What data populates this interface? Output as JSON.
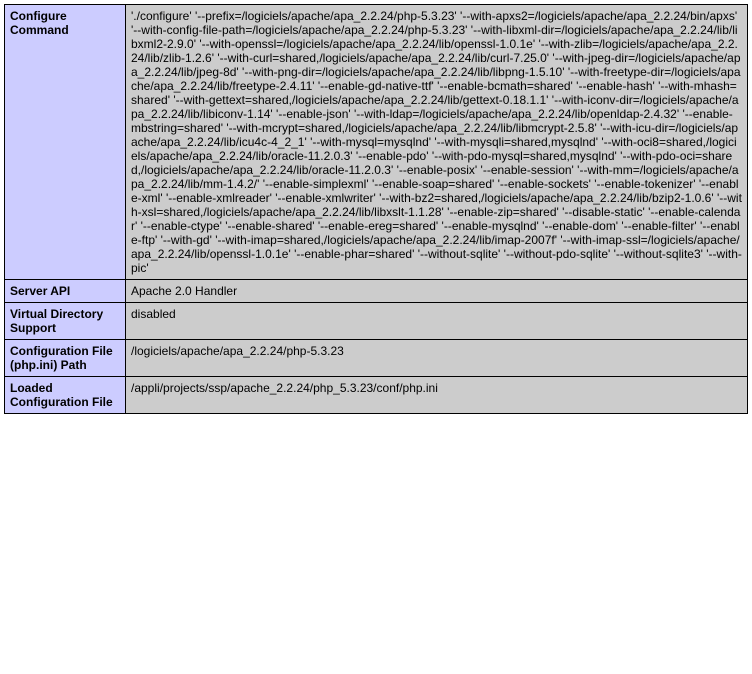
{
  "rows": [
    {
      "label": "Configure Command",
      "value": "'./configure' '--prefix=/logiciels/apache/apa_2.2.24/php-5.3.23' '--with-apxs2=/logiciels/apache/apa_2.2.24/bin/apxs' '--with-config-file-path=/logiciels/apache/apa_2.2.24/php-5.3.23' '--with-libxml-dir=/logiciels/apache/apa_2.2.24/lib/libxml2-2.9.0' '--with-openssl=/logiciels/apache/apa_2.2.24/lib/openssl-1.0.1e' '--with-zlib=/logiciels/apache/apa_2.2.24/lib/zlib-1.2.6' '--with-curl=shared,/logiciels/apache/apa_2.2.24/lib/curl-7.25.0' '--with-jpeg-dir=/logiciels/apache/apa_2.2.24/lib/jpeg-8d' '--with-png-dir=/logiciels/apache/apa_2.2.24/lib/libpng-1.5.10' '--with-freetype-dir=/logiciels/apache/apa_2.2.24/lib/freetype-2.4.11' '--enable-gd-native-ttf' '--enable-bcmath=shared' '--enable-hash' '--with-mhash=shared' '--with-gettext=shared,/logiciels/apache/apa_2.2.24/lib/gettext-0.18.1.1' '--with-iconv-dir=/logiciels/apache/apa_2.2.24/lib/libiconv-1.14' '--enable-json' '--with-ldap=/logiciels/apache/apa_2.2.24/lib/openldap-2.4.32' '--enable-mbstring=shared' '--with-mcrypt=shared,/logiciels/apache/apa_2.2.24/lib/libmcrypt-2.5.8' '--with-icu-dir=/logiciels/apache/apa_2.2.24/lib/icu4c-4_2_1' '--with-mysql=mysqlnd' '--with-mysqli=shared,mysqlnd' '--with-oci8=shared,/logiciels/apache/apa_2.2.24/lib/oracle-11.2.0.3' '--enable-pdo' '--with-pdo-mysql=shared,mysqlnd' '--with-pdo-oci=shared,/logiciels/apache/apa_2.2.24/lib/oracle-11.2.0.3' '--enable-posix' '--enable-session' '--with-mm=/logiciels/apache/apa_2.2.24/lib/mm-1.4.2/' '--enable-simplexml' '--enable-soap=shared' '--enable-sockets' '--enable-tokenizer' '--enable-xml' '--enable-xmlreader' '--enable-xmlwriter' '--with-bz2=shared,/logiciels/apache/apa_2.2.24/lib/bzip2-1.0.6' '--with-xsl=shared,/logiciels/apache/apa_2.2.24/lib/libxslt-1.1.28' '--enable-zip=shared' '--disable-static' '--enable-calendar' '--enable-ctype' '--enable-shared' '--enable-ereg=shared' '--enable-mysqlnd' '--enable-dom' '--enable-filter' '--enable-ftp' '--with-gd' '--with-imap=shared,/logiciels/apache/apa_2.2.24/lib/imap-2007f' '--with-imap-ssl=/logiciels/apache/apa_2.2.24/lib/openssl-1.0.1e' '--enable-phar=shared' '--without-sqlite' '--without-pdo-sqlite' '--without-sqlite3' '--with-pic'"
    },
    {
      "label": "Server API",
      "value": "Apache 2.0 Handler"
    },
    {
      "label": "Virtual Directory Support",
      "value": "disabled"
    },
    {
      "label": "Configuration File (php.ini) Path",
      "value": "/logiciels/apache/apa_2.2.24/php-5.3.23"
    },
    {
      "label": "Loaded Configuration File",
      "value": "/appli/projects/ssp/apache_2.2.24/php_5.3.23/conf/php.ini"
    }
  ]
}
